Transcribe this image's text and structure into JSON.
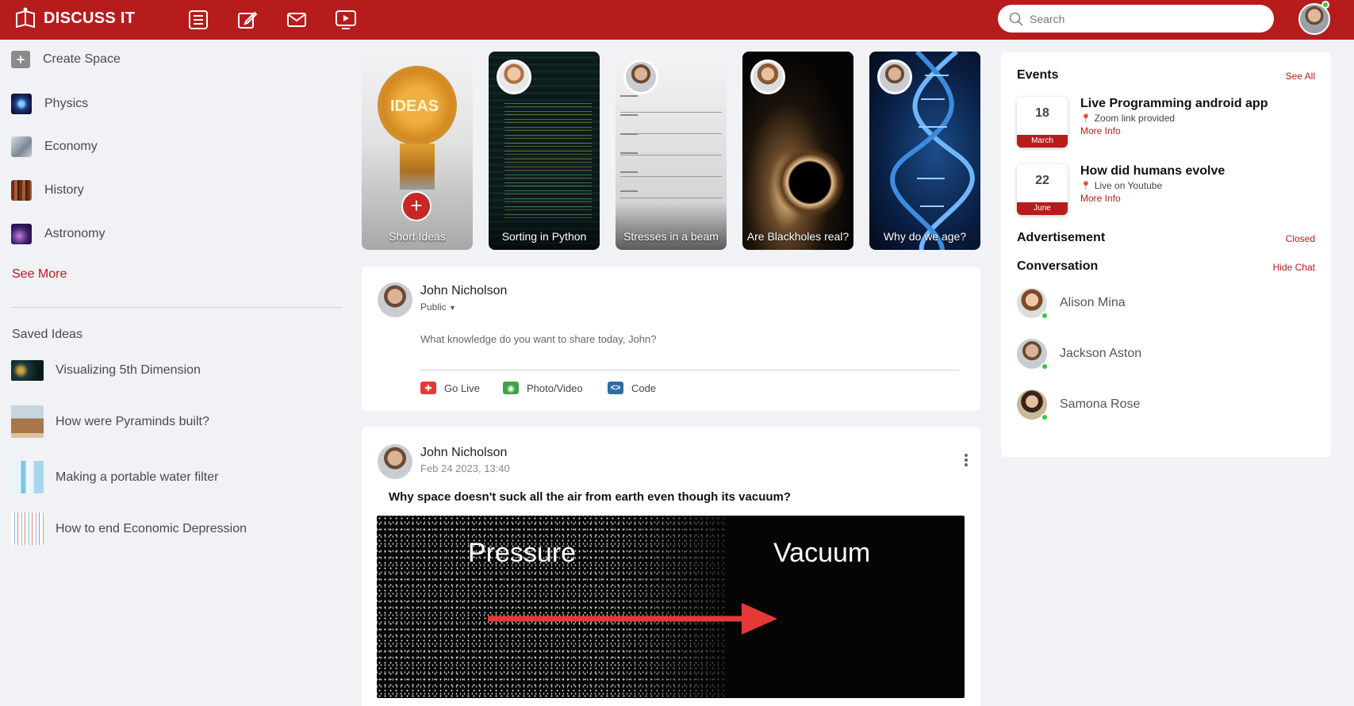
{
  "app": {
    "brand": "DISCUSS IT",
    "search_placeholder": "Search"
  },
  "nav_icons": [
    "list-icon",
    "edit-icon",
    "mail-icon",
    "video-icon"
  ],
  "sidebar": {
    "create": "Create Space",
    "spaces": [
      {
        "label": "Physics",
        "color": "#2a3d8f"
      },
      {
        "label": "Economy",
        "color": "#9aa4ad"
      },
      {
        "label": "History",
        "color": "#8b4a2b"
      },
      {
        "label": "Astronomy",
        "color": "#5b3d8f"
      }
    ],
    "see_more": "See More",
    "saved_title": "Saved Ideas",
    "saved": [
      {
        "label": "Visualizing 5th Dimension"
      },
      {
        "label": "How were Pyraminds built?"
      },
      {
        "label": "Making a portable water filter"
      },
      {
        "label": "How to end Economic Depression"
      }
    ]
  },
  "stories": [
    {
      "label": "Short Ideas"
    },
    {
      "label": "Sorting in Python"
    },
    {
      "label": "Stresses in a beam"
    },
    {
      "label": "Are Blackholes real?"
    },
    {
      "label": "Why do we age?"
    }
  ],
  "composer": {
    "name": "John Nicholson",
    "visibility": "Public",
    "prompt": "What knowledge do you want to share today, John?",
    "actions": [
      "Go Live",
      "Photo/Video",
      "Code"
    ]
  },
  "post": {
    "name": "John Nicholson",
    "date": "Feb 24 2023, 13:40",
    "question": "Why space doesn't suck all the air from earth even though its vacuum?",
    "image_left": "Pressure",
    "image_right": "Vacuum"
  },
  "events": {
    "title": "Events",
    "see_all": "See All",
    "items": [
      {
        "day": "18",
        "month": "March",
        "title": "Live Programming android app",
        "sub": "Zoom link provided",
        "more": "More Info"
      },
      {
        "day": "22",
        "month": "June",
        "title": "How did humans evolve",
        "sub": "Live on Youtube",
        "more": "More Info"
      }
    ]
  },
  "advertisement": {
    "title": "Advertisement",
    "status": "Closed"
  },
  "conversation": {
    "title": "Conversation",
    "hide": "Hide Chat",
    "people": [
      {
        "name": "Alison Mina"
      },
      {
        "name": "Jackson Aston"
      },
      {
        "name": "Samona Rose"
      }
    ]
  },
  "colors": {
    "brand": "#b71c1c",
    "online": "#2ecc40"
  }
}
